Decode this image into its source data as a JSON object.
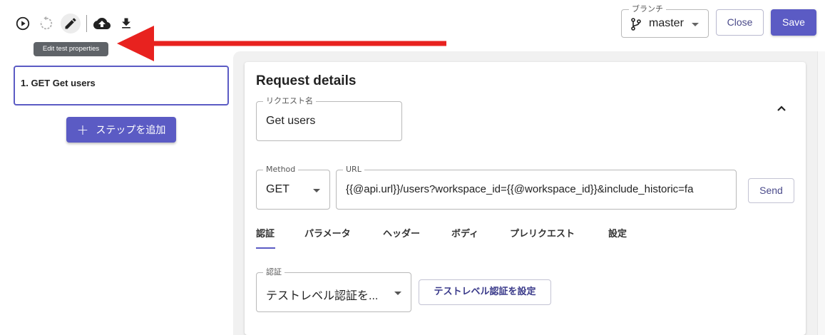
{
  "toolbar": {
    "icons": [
      "play-circle-icon",
      "reset-icon",
      "edit-icon",
      "cloud-upload-icon",
      "download-icon"
    ],
    "tooltip": "Edit test properties"
  },
  "branch": {
    "legend": "ブランチ",
    "value": "master"
  },
  "header_buttons": {
    "close": "Close",
    "save": "Save"
  },
  "steps": [
    {
      "label": "1. GET Get users"
    }
  ],
  "add_step_label": "ステップを追加",
  "request": {
    "title": "Request details",
    "name_legend": "リクエスト名",
    "name_value": "Get users",
    "method_legend": "Method",
    "method_value": "GET",
    "url_legend": "URL",
    "url_value": "{{@api.url}}/users?workspace_id={{@workspace_id}}&include_historic=fa",
    "send_label": "Send",
    "tabs": [
      "認証",
      "パラメータ",
      "ヘッダー",
      "ボディ",
      "プレリクエスト",
      "設定"
    ],
    "active_tab": "認証",
    "auth_legend": "認証",
    "auth_value": "テストレベル認証を...",
    "test_auth_button": "テストレベル認証を設定"
  },
  "colors": {
    "accent": "#5b5bc4",
    "arrow": "#e8221f"
  }
}
